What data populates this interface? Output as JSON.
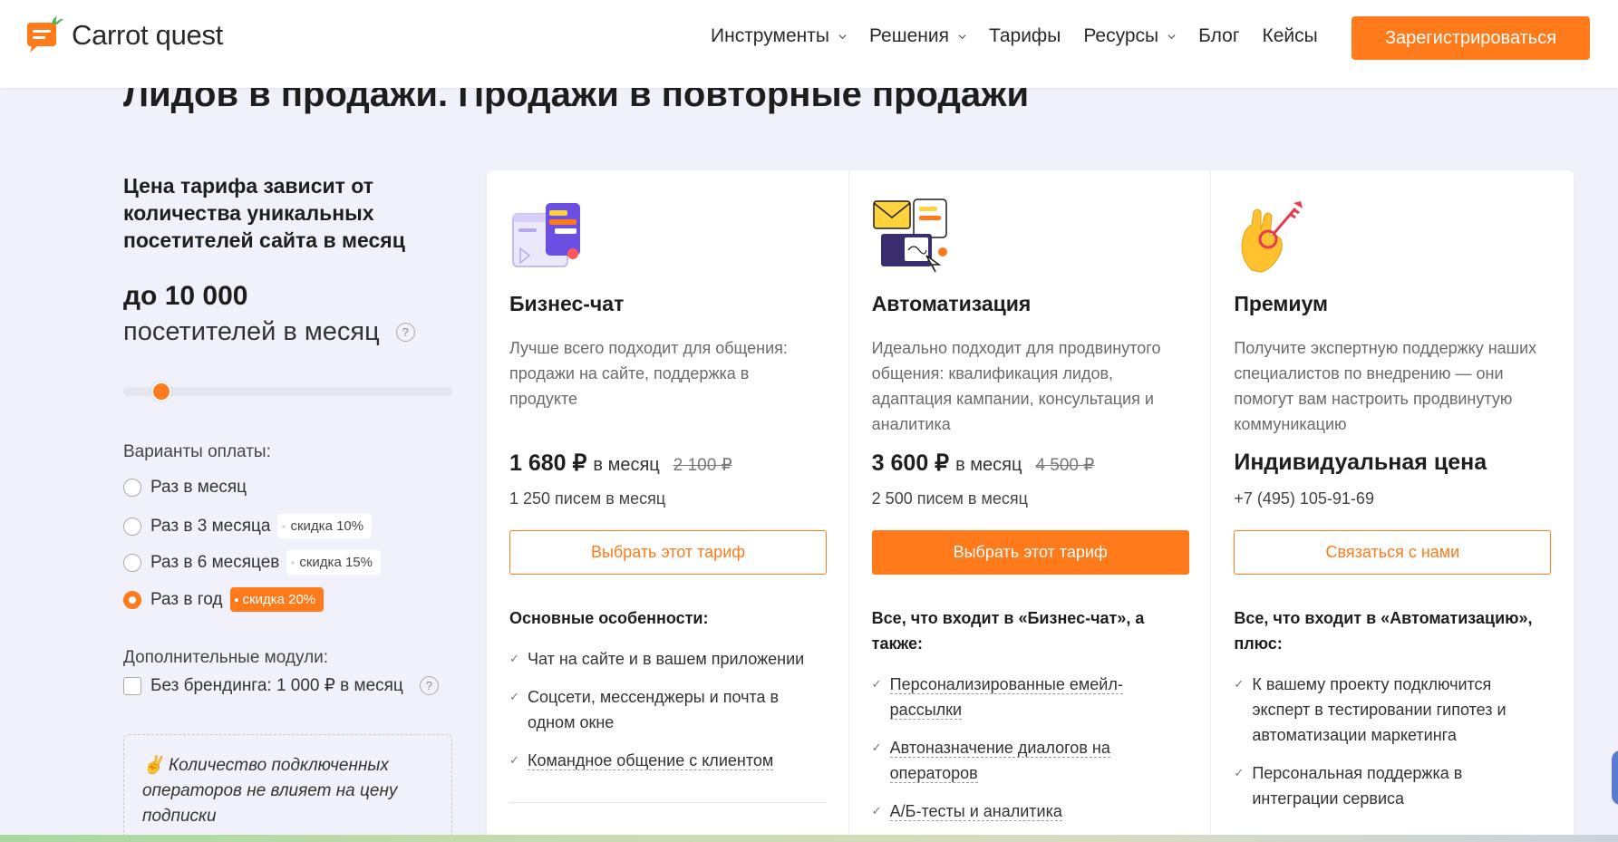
{
  "header": {
    "logo_text": "Carrot quest",
    "nav": [
      {
        "label": "Инструменты",
        "has_dropdown": true
      },
      {
        "label": "Решения",
        "has_dropdown": true
      },
      {
        "label": "Тарифы",
        "has_dropdown": false
      },
      {
        "label": "Ресурсы",
        "has_dropdown": true
      },
      {
        "label": "Блог",
        "has_dropdown": false
      },
      {
        "label": "Кейсы",
        "has_dropdown": false
      }
    ],
    "register_label": "Зарегистрироваться"
  },
  "hero": {
    "title": "Лидов в продажи. Продажи в повторные продажи"
  },
  "left": {
    "price_note": "Цена тарифа зависит от количества уникальных посетителей сайта в месяц",
    "visitors_count": "до 10 000",
    "visitors_label": "посетителей в месяц",
    "slider_value_fraction": 0.09,
    "payment_title": "Варианты оплаты:",
    "payment_options": [
      {
        "label": "Раз в месяц",
        "discount": "",
        "selected": false
      },
      {
        "label": "Раз в 3 месяца",
        "discount": "скидка 10%",
        "selected": false
      },
      {
        "label": "Раз в 6 месяцев",
        "discount": "скидка 15%",
        "selected": false
      },
      {
        "label": "Раз в год",
        "discount": "скидка 20%",
        "selected": true
      }
    ],
    "modules_title": "Дополнительные модули:",
    "module_option": "Без брендинга: 1 000 ₽ в месяц",
    "note": "Количество подключенных операторов не влияет на цену подписки",
    "note_icon": "✌"
  },
  "plans": [
    {
      "name": "Бизнес-чат",
      "desc": "Лучше всего подходит для общения: продажи на сайте, поддержка в продукте",
      "price": "1 680 ₽",
      "unit": "в месяц",
      "old_price": "2 100 ₽",
      "sub": "1 250 писем в месяц",
      "button": "Выбрать этот тариф",
      "features_title": "Основные особенности:",
      "features": [
        "Чат на сайте и в вашем приложении",
        "Соцсети, мессенджеры и почта в одном окне",
        "Командное общение с клиентом"
      ]
    },
    {
      "name": "Автоматизация",
      "desc": "Идеально подходит для продвинутого общения: квалификация лидов, адаптация кампании, консультация и аналитика",
      "price": "3 600 ₽",
      "unit": "в месяц",
      "old_price": "4 500 ₽",
      "sub": "2 500 писем в месяц",
      "button": "Выбрать этот тариф",
      "features_title": "Все, что входит в «Бизнес-чат», а также:",
      "features": [
        "Персонализированные емейл-рассылки",
        "Автоназначение диалогов на операторов",
        "А/Б-тесты и аналитика"
      ]
    },
    {
      "name": "Премиум",
      "desc": "Получите экспертную поддержку наших специалистов по внедрению — они помогут вам настроить продвинутую коммуникацию",
      "price": "Индивидуальная цена",
      "sub": "+7 (495) 105-91-69",
      "button": "Связаться с нами",
      "features_title": "Все, что входит в «Автоматизацию», плюс:",
      "features": [
        "К вашему проекту подключится эксперт в тестировании гипотез и автоматизации маркетинга",
        "Персональная поддержка в интеграции сервиса"
      ]
    }
  ],
  "colors": {
    "accent": "#ff7a1a",
    "background": "#f1f1fb"
  }
}
